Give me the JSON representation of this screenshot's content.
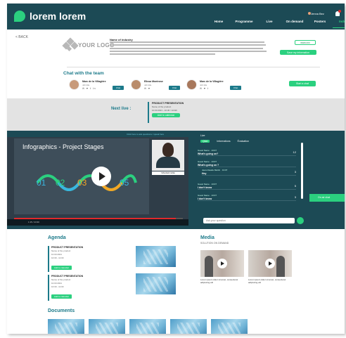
{
  "header": {
    "brand": "lorem lorem",
    "nav": [
      {
        "label": "Home",
        "active": false
      },
      {
        "label": "Programme",
        "active": false
      },
      {
        "label": "Live",
        "active": false
      },
      {
        "label": "On demand",
        "active": false
      },
      {
        "label": "Posters",
        "active": false
      },
      {
        "label": "Industry",
        "active": true
      }
    ],
    "user_name": "Jenna Bez",
    "colors": {
      "header_bg": "#1c4a55",
      "accent": "#2bd07f",
      "teal": "#1c7a8a",
      "notif": "#e0292b"
    }
  },
  "industry": {
    "back_label": "< BACK",
    "logo_text": "YOUR LOGO",
    "title": "Name of industry",
    "buttons": {
      "website": "www.xxx",
      "downloads": "Save my information"
    }
  },
  "team": {
    "title": "Chat with the team",
    "members": [
      {
        "name": "Marc de la Villagière",
        "role": "Job title",
        "social": "✉ ♥ t in",
        "chat": "Chat"
      },
      {
        "name": "Elissa Montrose",
        "role": "Job title",
        "social": "✉ ♥",
        "chat": "Chat"
      },
      {
        "name": "Marc de la Villagière",
        "role": "Job title",
        "social": "✉ ♥ t",
        "chat": "Chat"
      }
    ],
    "group_chat": "Start a chat"
  },
  "next_live": {
    "label": "Next live :",
    "title": "PRODUCT PRESENTATION",
    "subtitle": "Name of the product",
    "date": "10.03.2021 - 10.30 / 11h30",
    "button": "Add to calendar"
  },
  "video": {
    "link_text": "Click here to ask questions / speak here",
    "slide_title": "Infographics - Project Stages",
    "stages": [
      "01",
      "02",
      "03",
      "04",
      "05"
    ],
    "speaker_label": "SPEAKER NAME",
    "time": "1:15 / 24:30",
    "progress": 0.96
  },
  "qa": {
    "live_label": "Live",
    "tabs": [
      "Q&A",
      "Informations",
      "Évaluation"
    ],
    "items": [
      {
        "user": "Guest Name · 13:07",
        "text": "What's going on?",
        "count": "12",
        "reply": false
      },
      {
        "user": "Guest Name · 13:07",
        "text": "What's going on ?",
        "count": "",
        "reply": false
      },
      {
        "user": "Jean-Claude Martin · 13:07",
        "text": "Hey",
        "count": "3",
        "reply": true
      },
      {
        "user": "Guest Name · 13:07",
        "text": "I don't know",
        "count": "5",
        "reply": false
      },
      {
        "user": "Guest Name · 13:07",
        "text": "I don't know",
        "count": "3",
        "reply": false
      }
    ],
    "input_placeholder": "Ask your question",
    "side_chat": "On air chat"
  },
  "agenda": {
    "title": "Agenda",
    "items": [
      {
        "title": "PRODUCT PRESENTATION",
        "subtitle": "Name of the product",
        "date": "10.03.2021",
        "time": "10:30 - 11:00",
        "button": "Add to calendar"
      },
      {
        "title": "PRODUCT PRESENTATION",
        "subtitle": "Name of the product",
        "date": "10.03.2021",
        "time": "10:30 - 11:00",
        "button": "Add to calendar"
      }
    ]
  },
  "media": {
    "title": "Media",
    "subtitle": "SOLUTION ON DEMAND",
    "items": [
      {
        "caption": "Lorem ipsum dolor sit amet, consectetur adipiscing elit"
      },
      {
        "caption": "Lorem ipsum dolor sit amet, consectetur adipiscing elit"
      }
    ]
  },
  "documents": {
    "title": "Documents",
    "count": 5
  }
}
